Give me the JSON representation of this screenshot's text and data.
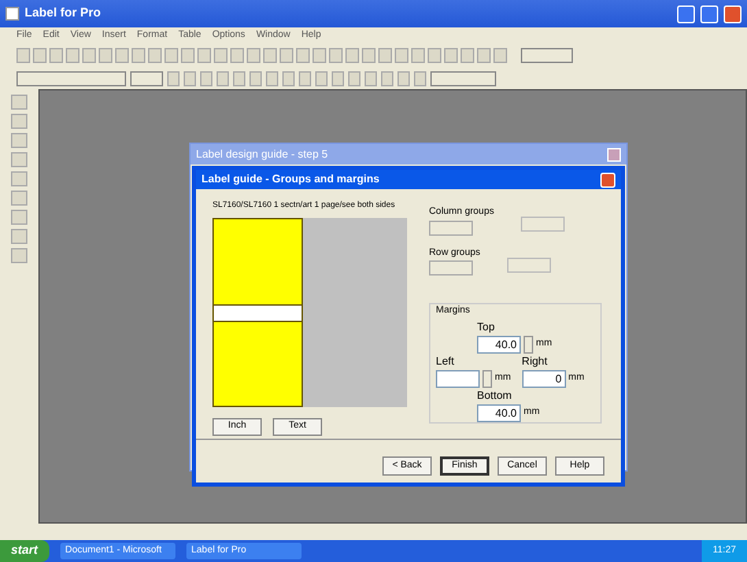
{
  "window": {
    "title": "Label for Pro"
  },
  "menu": [
    "File",
    "Edit",
    "View",
    "Insert",
    "Format",
    "Table",
    "Options",
    "Window",
    "Help"
  ],
  "back_dialog": {
    "title": "Label design guide - step 5"
  },
  "dialog": {
    "title": "Label guide - Groups and margins",
    "preview_caption": "SL7160/SL7160 1 sectn/art 1 page/see both sides",
    "preview_buttons": [
      "Inch",
      "Text"
    ],
    "column_groups": {
      "label": "Column groups"
    },
    "row_groups": {
      "label": "Row groups"
    },
    "margins": {
      "label": "Margins",
      "fields": [
        {
          "kind": "spin",
          "label": "Top",
          "value": "40.0",
          "unit": "mm"
        },
        {
          "kind": "spin",
          "label": "Left",
          "unit": "mm"
        },
        {
          "kind": "plain",
          "label": "Right",
          "value": "0",
          "unit": "mm"
        },
        {
          "kind": "plain",
          "label": "Bottom",
          "value": "40.0",
          "unit": "mm"
        }
      ]
    },
    "buttons": [
      {
        "label": "< Back",
        "selected": false
      },
      {
        "label": "Finish",
        "selected": true
      },
      {
        "label": "Cancel",
        "selected": false
      },
      {
        "label": "Help",
        "selected": false
      }
    ]
  },
  "taskbar": {
    "start": "start",
    "tasks": [
      "Document1 - Microsoft",
      "Label for Pro"
    ],
    "clock": "11:27"
  }
}
